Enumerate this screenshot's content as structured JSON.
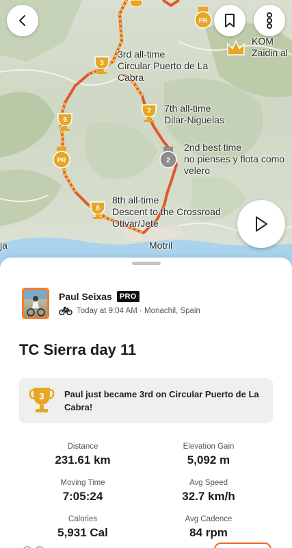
{
  "map": {
    "labels": {
      "seg_3rd": [
        "3rd all-time",
        "Circular Puerto de La",
        "Cabra"
      ],
      "seg_7th": [
        "7th all-time",
        "Dilar-Niguelas"
      ],
      "seg_2nd": [
        "2nd best time",
        "no pienses y flota como",
        "velero"
      ],
      "seg_8th": [
        "8th all-time",
        "Descent to the Crossroad",
        "Otivar/Jete"
      ],
      "kom": [
        "KOM",
        "Zaidin al"
      ],
      "town_motril": "Motril",
      "town_left": "ja"
    },
    "markers": {
      "pr": "PR",
      "n3": "3",
      "n7": "7",
      "n2": "2",
      "n9": "9",
      "n8": "8"
    }
  },
  "buttons": {
    "back": "back-icon",
    "bookmark": "bookmark-icon",
    "more": "more-vertical-icon",
    "play": "play-icon"
  },
  "athlete": {
    "name": "Paul  Seixas",
    "badge": "PRO",
    "meta": "Today at 9:04 AM · Monachil, Spain"
  },
  "activity": {
    "title": "TC Sierra day 11",
    "achievement_rank": "3",
    "achievement_text": "Paul  just became 3rd on Circular Puerto de La Cabra!"
  },
  "stats": {
    "distance_label": "Distance",
    "distance_value": "231.61 km",
    "elev_label": "Elevation Gain",
    "elev_value": "5,092 m",
    "moving_label": "Moving Time",
    "moving_value": "7:05:24",
    "speed_label": "Avg Speed",
    "speed_value": "32.7 km/h",
    "cal_label": "Calories",
    "cal_value": "5,931 Cal",
    "cad_label": "Avg Cadence",
    "cad_value": "84 rpm"
  },
  "colors": {
    "accent": "#f26522",
    "gold": "#e8a526",
    "silver": "#8e8e8e"
  }
}
